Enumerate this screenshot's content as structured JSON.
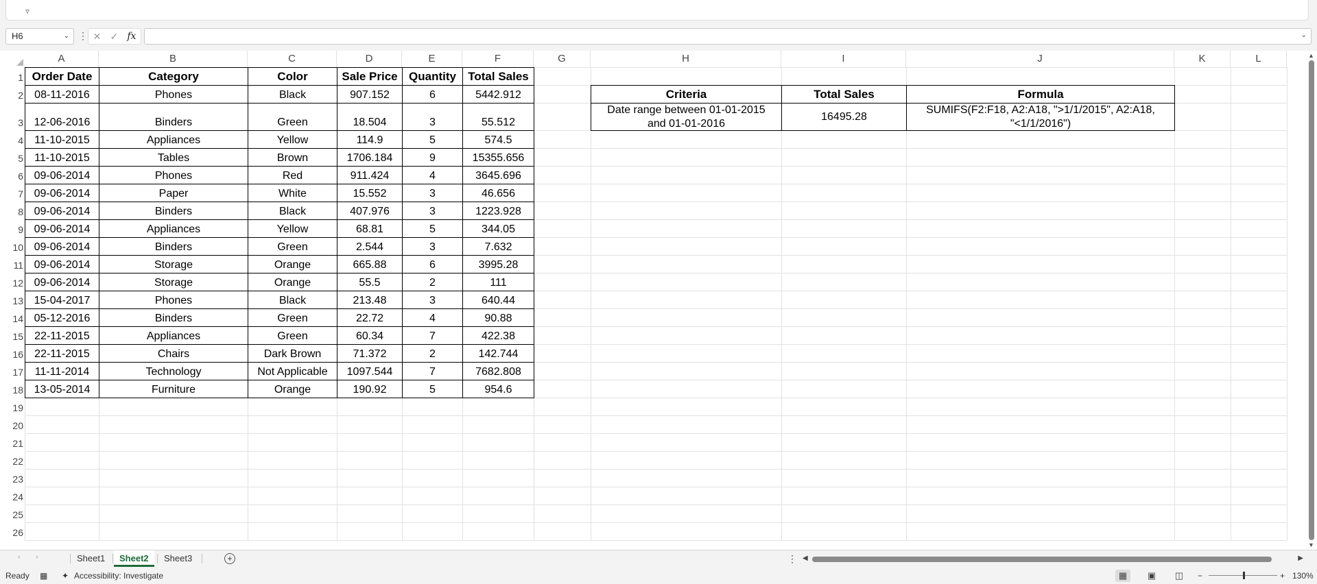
{
  "ribbon": {
    "toggle_icon": "chevron-down-icon"
  },
  "formula_bar": {
    "name_box": "H6",
    "formula": "",
    "fx_label": "fx"
  },
  "columns": [
    "A",
    "B",
    "C",
    "D",
    "E",
    "F",
    "G",
    "H",
    "I",
    "J",
    "K",
    "L"
  ],
  "rows": [
    "1",
    "2",
    "3",
    "4",
    "5",
    "6",
    "7",
    "8",
    "9",
    "10",
    "11",
    "12",
    "13",
    "14",
    "15",
    "16",
    "17",
    "18",
    "19",
    "20",
    "21",
    "22",
    "23",
    "24",
    "25",
    "26"
  ],
  "table": {
    "headers": [
      "Order Date",
      "Category",
      "Color",
      "Sale Price",
      "Quantity",
      "Total Sales"
    ],
    "rows": [
      [
        "08-11-2016",
        "Phones",
        "Black",
        "907.152",
        "6",
        "5442.912"
      ],
      [
        "12-06-2016",
        "Binders",
        "Green",
        "18.504",
        "3",
        "55.512"
      ],
      [
        "11-10-2015",
        "Appliances",
        "Yellow",
        "114.9",
        "5",
        "574.5"
      ],
      [
        "11-10-2015",
        "Tables",
        "Brown",
        "1706.184",
        "9",
        "15355.656"
      ],
      [
        "09-06-2014",
        "Phones",
        "Red",
        "911.424",
        "4",
        "3645.696"
      ],
      [
        "09-06-2014",
        "Paper",
        "White",
        "15.552",
        "3",
        "46.656"
      ],
      [
        "09-06-2014",
        "Binders",
        "Black",
        "407.976",
        "3",
        "1223.928"
      ],
      [
        "09-06-2014",
        "Appliances",
        "Yellow",
        "68.81",
        "5",
        "344.05"
      ],
      [
        "09-06-2014",
        "Binders",
        "Green",
        "2.544",
        "3",
        "7.632"
      ],
      [
        "09-06-2014",
        "Storage",
        "Orange",
        "665.88",
        "6",
        "3995.28"
      ],
      [
        "09-06-2014",
        "Storage",
        "Orange",
        "55.5",
        "2",
        "111"
      ],
      [
        "15-04-2017",
        "Phones",
        "Black",
        "213.48",
        "3",
        "640.44"
      ],
      [
        "05-12-2016",
        "Binders",
        "Green",
        "22.72",
        "4",
        "90.88"
      ],
      [
        "22-11-2015",
        "Appliances",
        "Green",
        "60.34",
        "7",
        "422.38"
      ],
      [
        "22-11-2015",
        "Chairs",
        "Dark Brown",
        "71.372",
        "2",
        "142.744"
      ],
      [
        "11-11-2014",
        "Technology",
        "Not Applicable",
        "1097.544",
        "7",
        "7682.808"
      ],
      [
        "13-05-2014",
        "Furniture",
        "Orange",
        "190.92",
        "5",
        "954.6"
      ]
    ]
  },
  "criteria_table": {
    "headers": [
      "Criteria",
      "Total Sales",
      "Formula"
    ],
    "criteria_line1": "Date range between 01-01-2015",
    "criteria_line2": "and 01-01-2016",
    "total": "16495.28",
    "formula_line1": "SUMIFS(F2:F18, A2:A18, \">1/1/2015\", A2:A18,",
    "formula_line2": "\"<1/1/2016\")"
  },
  "sheets": [
    "Sheet1",
    "Sheet2",
    "Sheet3"
  ],
  "active_sheet": "Sheet2",
  "status": {
    "ready": "Ready",
    "accessibility": "Accessibility: Investigate",
    "zoom": "130%"
  },
  "colors": {
    "active_tab": "#1d6b3a",
    "gridline": "#e1e1e1"
  }
}
